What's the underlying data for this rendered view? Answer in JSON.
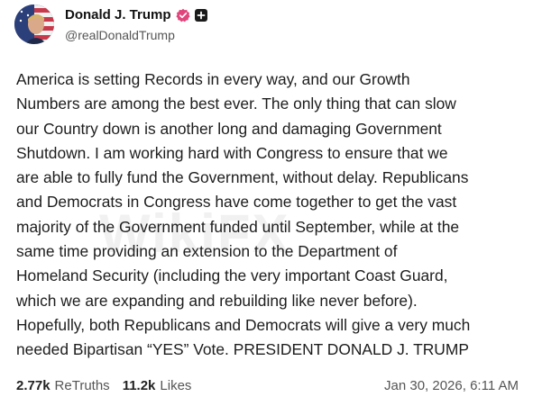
{
  "author": {
    "display_name": "Donald J. Trump",
    "handle": "@realDonaldTrump"
  },
  "post": {
    "text": "America is setting Records in every way, and our Growth\nNumbers are among the best ever. The only thing that can slow\nour Country down is another long and damaging Government\nShutdown. I am working hard with Congress to ensure that we\nare able to fully fund the Government, without delay. Republicans\nand Democrats in Congress have come together to get the vast\nmajority of the Government funded until September, while at the\nsame time providing an extension to the Department of\nHomeland Security (including the very important Coast Guard,\nwhich we are expanding and rebuilding like never before).\nHopefully, both Republicans and Democrats will give a very much\nneeded Bipartisan “YES” Vote. PRESIDENT DONALD J. TRUMP"
  },
  "stats": {
    "retruths_value": "2.77k",
    "retruths_label": "ReTruths",
    "likes_value": "11.2k",
    "likes_label": "Likes"
  },
  "timestamp": "Jan 30, 2026, 6:11 AM",
  "watermark": "WikiFX",
  "icons": {
    "verified": "verified-badge-icon",
    "plus": "plus-badge-icon"
  },
  "colors": {
    "verified_badge": "#e0457b",
    "text": "#1d1d1d",
    "muted": "#555555"
  }
}
